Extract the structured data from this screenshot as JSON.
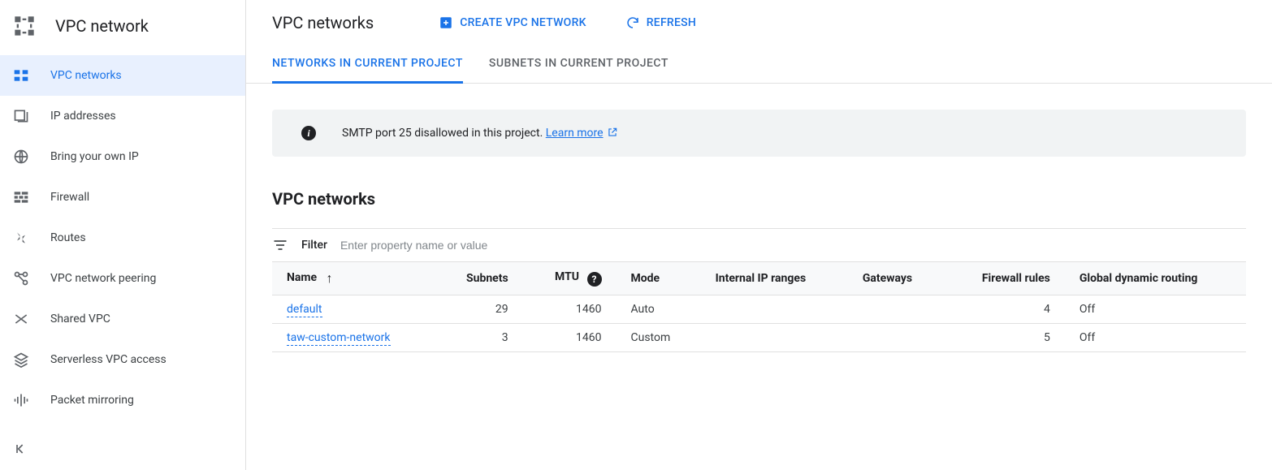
{
  "sidebar": {
    "title": "VPC network",
    "items": [
      {
        "label": "VPC networks",
        "active": true
      },
      {
        "label": "IP addresses"
      },
      {
        "label": "Bring your own IP"
      },
      {
        "label": "Firewall"
      },
      {
        "label": "Routes"
      },
      {
        "label": "VPC network peering"
      },
      {
        "label": "Shared VPC"
      },
      {
        "label": "Serverless VPC access"
      },
      {
        "label": "Packet mirroring"
      }
    ]
  },
  "header": {
    "title": "VPC networks",
    "create_label": "CREATE VPC NETWORK",
    "refresh_label": "REFRESH"
  },
  "tabs": [
    {
      "label": "NETWORKS IN CURRENT PROJECT",
      "active": true
    },
    {
      "label": "SUBNETS IN CURRENT PROJECT"
    }
  ],
  "banner": {
    "text": "SMTP port 25 disallowed in this project. ",
    "link_label": "Learn more"
  },
  "section_title": "VPC networks",
  "filter": {
    "label": "Filter",
    "placeholder": "Enter property name or value"
  },
  "table": {
    "columns": [
      {
        "key": "name",
        "label": "Name",
        "sorted": "asc"
      },
      {
        "key": "subnets",
        "label": "Subnets",
        "align": "num"
      },
      {
        "key": "mtu",
        "label": "MTU",
        "align": "num",
        "help": true
      },
      {
        "key": "mode",
        "label": "Mode"
      },
      {
        "key": "internal_ip_ranges",
        "label": "Internal IP ranges"
      },
      {
        "key": "gateways",
        "label": "Gateways"
      },
      {
        "key": "firewall_rules",
        "label": "Firewall rules",
        "align": "num"
      },
      {
        "key": "global_dynamic_routing",
        "label": "Global dynamic routing"
      }
    ],
    "rows": [
      {
        "name": "default",
        "subnets": "29",
        "mtu": "1460",
        "mode": "Auto",
        "internal_ip_ranges": "",
        "gateways": "",
        "firewall_rules": "4",
        "global_dynamic_routing": "Off"
      },
      {
        "name": "taw-custom-network",
        "subnets": "3",
        "mtu": "1460",
        "mode": "Custom",
        "internal_ip_ranges": "",
        "gateways": "",
        "firewall_rules": "5",
        "global_dynamic_routing": "Off"
      }
    ]
  }
}
